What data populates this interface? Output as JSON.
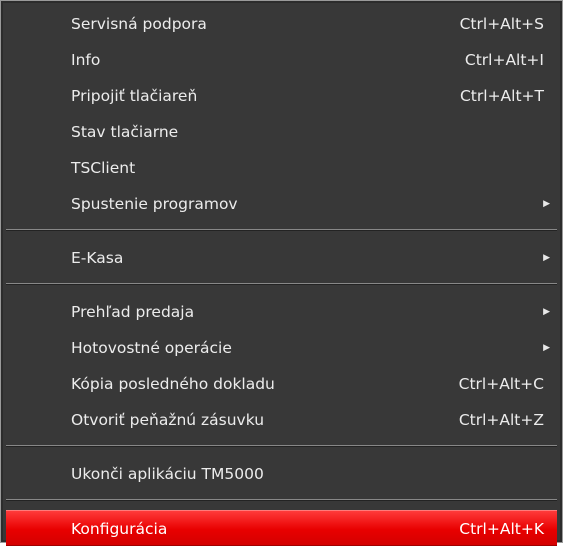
{
  "menu": {
    "groups": [
      {
        "items": [
          {
            "label": "Servisná podpora",
            "shortcut": "Ctrl+Alt+S"
          },
          {
            "label": "Info",
            "shortcut": "Ctrl+Alt+I"
          },
          {
            "label": "Pripojiť tlačiareň",
            "shortcut": "Ctrl+Alt+T"
          },
          {
            "label": "Stav tlačiarne",
            "shortcut": ""
          },
          {
            "label": "TSClient",
            "shortcut": ""
          },
          {
            "label": "Spustenie programov",
            "shortcut": "",
            "submenu_icon": "submenu-arrow-icon"
          }
        ]
      },
      {
        "items": [
          {
            "label": "E-Kasa",
            "shortcut": "",
            "submenu_icon": "submenu-arrow-icon"
          }
        ]
      },
      {
        "items": [
          {
            "label": "Prehľad predaja",
            "shortcut": "",
            "submenu_icon": "submenu-arrow-icon"
          },
          {
            "label": "Hotovostné operácie",
            "shortcut": "",
            "submenu_icon": "submenu-arrow-icon"
          },
          {
            "label": "Kópia posledného dokladu",
            "shortcut": "Ctrl+Alt+C"
          },
          {
            "label": "Otvoriť peňažnú zásuvku",
            "shortcut": "Ctrl+Alt+Z"
          }
        ]
      },
      {
        "items": [
          {
            "label": "Ukonči aplikáciu TM5000",
            "shortcut": ""
          }
        ]
      },
      {
        "items": [
          {
            "label": "Konfigurácia",
            "shortcut": "Ctrl+Alt+K",
            "highlighted": true
          }
        ]
      }
    ],
    "colors": {
      "background": "#383838",
      "text": "#ececec",
      "highlight": "#e80000"
    }
  }
}
